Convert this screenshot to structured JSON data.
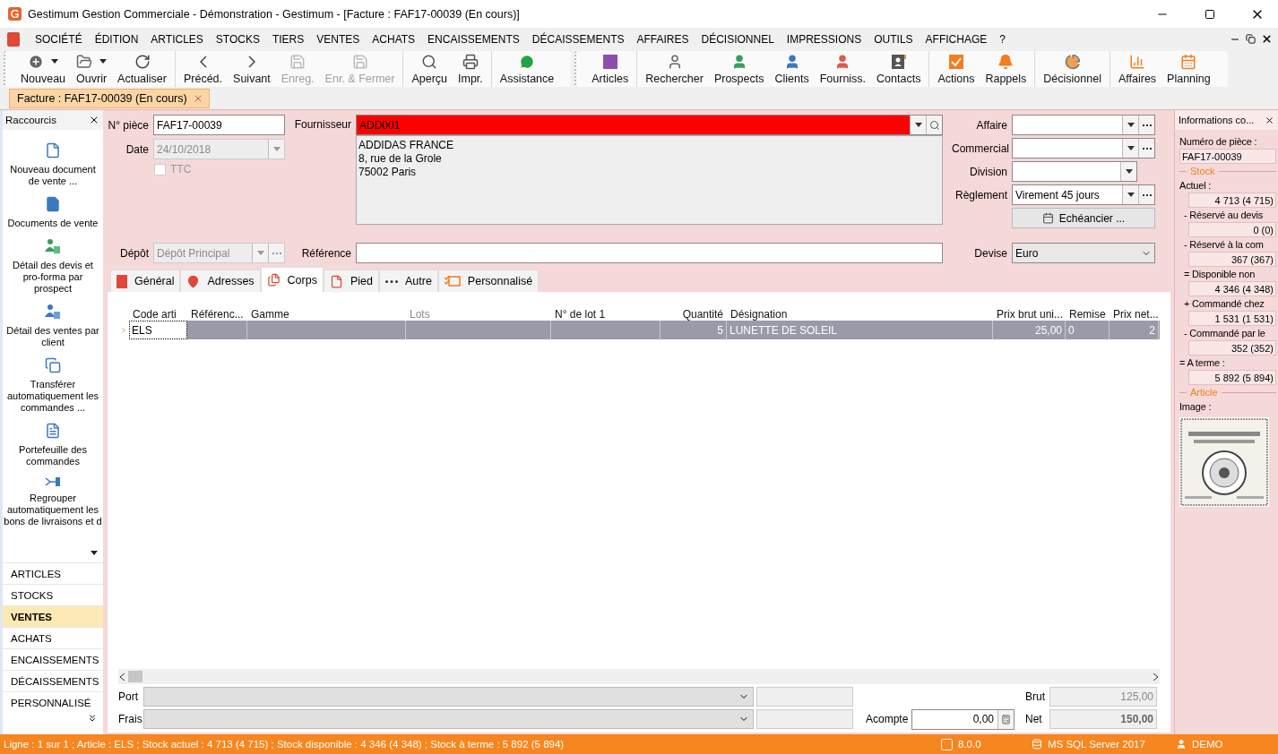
{
  "window": {
    "title": "Gestimum Gestion Commerciale - Démonstration - Gestimum - [Facture : FAF17-00039 (En cours)]"
  },
  "menu": [
    "SOCIÉTÉ",
    "ÉDITION",
    "ARTICLES",
    "STOCKS",
    "TIERS",
    "VENTES",
    "ACHATS",
    "ENCAISSEMENTS",
    "DÉCAISSEMENTS",
    "AFFAIRES",
    "DÉCISIONNEL",
    "IMPRESSIONS",
    "OUTILS",
    "AFFICHAGE",
    "?"
  ],
  "toolbars": [
    {
      "groups": [
        [
          {
            "label": "Nouveau",
            "disabled": false,
            "dropdown": true
          },
          {
            "label": "Ouvrir",
            "disabled": false,
            "dropdown": true
          },
          {
            "label": "Actualiser",
            "disabled": false,
            "dropdown": false
          }
        ],
        [
          {
            "label": "Précéd.",
            "disabled": false,
            "dropdown": false
          },
          {
            "label": "Suivant",
            "disabled": false,
            "dropdown": false
          },
          {
            "label": "Enreg.",
            "disabled": true,
            "dropdown": false
          },
          {
            "label": "Enr. & Fermer",
            "disabled": true,
            "dropdown": false
          }
        ],
        [
          {
            "label": "Aperçu",
            "disabled": false,
            "dropdown": false
          },
          {
            "label": "Impr.",
            "disabled": false,
            "dropdown": false
          }
        ],
        [
          {
            "label": "Assistance",
            "disabled": false,
            "dropdown": false
          }
        ]
      ]
    },
    {
      "groups": [
        [
          {
            "label": "Articles",
            "disabled": false,
            "dropdown": false
          }
        ],
        [
          {
            "label": "Rechercher",
            "disabled": false,
            "dropdown": false
          },
          {
            "label": "Prospects",
            "disabled": false,
            "dropdown": false
          },
          {
            "label": "Clients",
            "disabled": false,
            "dropdown": false
          },
          {
            "label": "Fourniss.",
            "disabled": false,
            "dropdown": false
          },
          {
            "label": "Contacts",
            "disabled": false,
            "dropdown": false
          }
        ],
        [
          {
            "label": "Actions",
            "disabled": false,
            "dropdown": false
          },
          {
            "label": "Rappels",
            "disabled": false,
            "dropdown": false
          }
        ],
        [
          {
            "label": "Décisionnel",
            "disabled": false,
            "dropdown": false
          }
        ],
        [
          {
            "label": "Affaires",
            "disabled": false,
            "dropdown": false
          },
          {
            "label": "Planning",
            "disabled": false,
            "dropdown": false
          }
        ]
      ]
    }
  ],
  "document_tabs": [
    {
      "label": "Facture : FAF17-00039 (En cours)",
      "selected": true
    }
  ],
  "sidebar": {
    "title": "Raccourcis",
    "shortcuts": [
      "Nouveau document de vente ...",
      "Documents de vente",
      "Détail des devis et pro-forma par prospect",
      "Détail des ventes par client",
      "Transférer automatiquement les commandes ...",
      "Portefeuille des commandes",
      "Regrouper automatiquement les bons de livraisons et d"
    ],
    "categories": [
      {
        "label": "ARTICLES",
        "selected": false
      },
      {
        "label": "STOCKS",
        "selected": false
      },
      {
        "label": "VENTES",
        "selected": true
      },
      {
        "label": "ACHATS",
        "selected": false
      },
      {
        "label": "ENCAISSEMENTS",
        "selected": false
      },
      {
        "label": "DÉCAISSEMENTS",
        "selected": false
      },
      {
        "label": "PERSONNALISÉ",
        "selected": false
      }
    ]
  },
  "form": {
    "piece": {
      "label": "N° pièce",
      "value": "FAF17-00039"
    },
    "date": {
      "label": "Date",
      "value": "24/10/2018",
      "disabled": true
    },
    "ttc": {
      "label": "TTC",
      "checked": false,
      "disabled": true
    },
    "fournisseur": {
      "label": "Fournisseur",
      "value": "ADD001",
      "address": [
        "ADDIDAS FRANCE",
        "8, rue de la Grole",
        "75002 Paris"
      ]
    },
    "depot": {
      "label": "Dépôt",
      "value": "Dépôt Principal",
      "disabled": true
    },
    "reference": {
      "label": "Référence"
    },
    "affaire": {
      "label": "Affaire"
    },
    "commercial": {
      "label": "Commercial"
    },
    "division": {
      "label": "Division"
    },
    "reglement": {
      "label": "Règlement",
      "value": "Virement 45 jours"
    },
    "echeancier": {
      "label": "Echéancier ..."
    },
    "devise": {
      "label": "Devise",
      "value": "Euro"
    }
  },
  "tabs": [
    {
      "label": "Général",
      "selected": false
    },
    {
      "label": "Adresses",
      "selected": false
    },
    {
      "label": "Corps",
      "selected": true
    },
    {
      "label": "Pied",
      "selected": false
    },
    {
      "label": "Autre",
      "selected": false
    },
    {
      "label": "Personnalisé",
      "selected": false
    }
  ],
  "table": {
    "columns": [
      {
        "label": "Code arti",
        "disabled": false
      },
      {
        "label": "Référenc...",
        "disabled": false
      },
      {
        "label": "Gamme",
        "disabled": false
      },
      {
        "label": "Lots",
        "disabled": true
      },
      {
        "label": "N° de lot 1",
        "disabled": false
      },
      {
        "label": "Quantité",
        "disabled": false
      },
      {
        "label": "Désignation",
        "disabled": false
      },
      {
        "label": "Prix brut uni...",
        "disabled": false
      },
      {
        "label": "Remise",
        "disabled": false
      },
      {
        "label": "Prix net...",
        "disabled": false
      }
    ],
    "rows": [
      {
        "selected": true,
        "cells": [
          "ELS",
          "",
          "",
          "",
          "",
          "5",
          "LUNETTE DE SOLEIL",
          "25,00",
          "0",
          "2"
        ]
      }
    ]
  },
  "footer": {
    "port": {
      "label": "Port"
    },
    "frais": {
      "label": "Frais"
    },
    "acompte": {
      "label": "Acompte",
      "value": "0,00"
    },
    "brut": {
      "label": "Brut",
      "value": "125,00"
    },
    "net": {
      "label": "Net",
      "value": "150,00"
    }
  },
  "info_panel": {
    "title": "Informations co...",
    "piece_label": "Numéro de pièce :",
    "piece_value": "FAF17-00039",
    "stock_title": "Stock",
    "stock": [
      {
        "label": "Actuel :",
        "value": "4 713 (4 715)"
      },
      {
        "label": "- Réservé au devis",
        "value": "0 (0)"
      },
      {
        "label": "- Réservé à la com",
        "value": "367 (367)"
      },
      {
        "label": "= Disponible non",
        "value": "4 346 (4 348)"
      },
      {
        "label": "+ Commandé chez",
        "value": "1 531 (1 531)"
      },
      {
        "label": "- Commandé par le",
        "value": "352 (352)"
      },
      {
        "label": "= A terme :",
        "value": "5 892 (5 894)"
      }
    ],
    "article_title": "Article",
    "image_label": "Image :"
  },
  "status_bar": {
    "text": "Ligne : 1 sur 1 ; Article : ELS ; Stock actuel : 4 713 (4 715) ; Stock disponible : 4 346 (4 348) ; Stock à terme : 5 892 (5 894)",
    "version": "8.0.0",
    "server": "MS SQL Server 2017",
    "user": "DEMO"
  }
}
